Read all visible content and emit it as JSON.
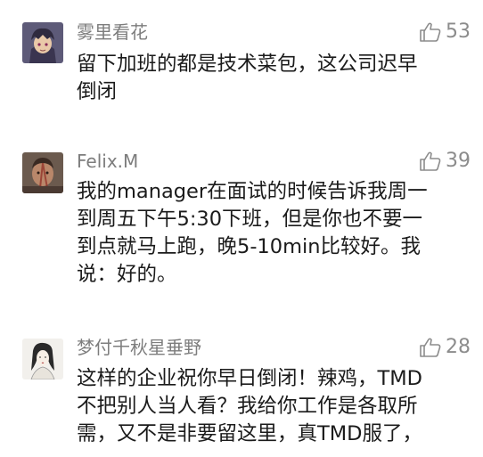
{
  "comments": [
    {
      "username": "雾里看花",
      "likes": "53",
      "lines": [
        "留下加班的都是技术菜包，这公司迟早",
        "倒闭"
      ]
    },
    {
      "username": "Felix.M",
      "likes": "39",
      "lines": [
        "我的manager在面试的时候告诉我周一",
        "到周五下午5:30下班，但是你也不要一",
        "到点就马上跑，晚5-10min比较好。我",
        "说：好的。"
      ]
    },
    {
      "username": "梦付千秋星垂野",
      "likes": "28",
      "lines": [
        "这样的企业祝你早日倒闭！辣鸡，TMD",
        "不把别人当人看？我给你工作是各取所",
        "需，又不是非要留这里，真TMD服了，"
      ]
    }
  ],
  "icons": {
    "like": "thumbs-up-icon"
  }
}
